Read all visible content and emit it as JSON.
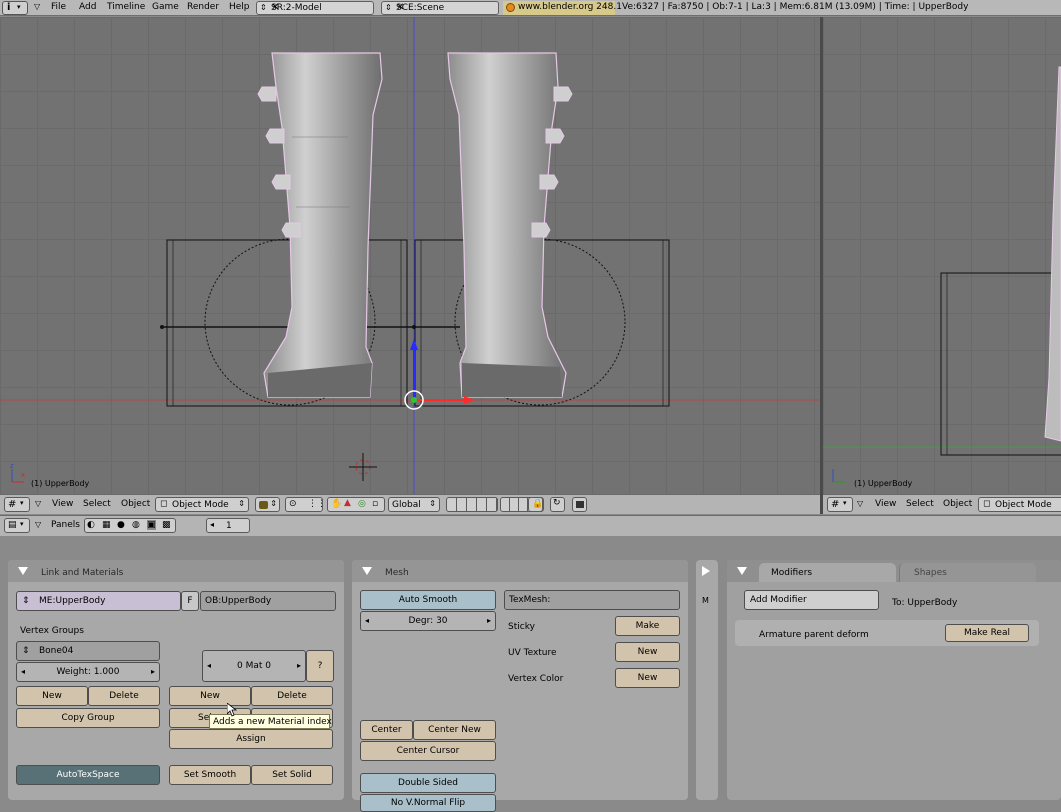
{
  "topbar": {
    "menus": [
      "File",
      "Add",
      "Timeline",
      "Game",
      "Render",
      "Help"
    ],
    "screen_field": "SR:2-Model",
    "scene_field": "SCE:Scene",
    "site": "www.blender.org 248.1",
    "stats": "Ve:6327 | Fa:8750 | Ob:7-1 | La:3 | Mem:6.81M (13.09M) | Time: | UpperBody"
  },
  "viewport_main": {
    "object_label": "(1) UpperBody"
  },
  "viewport_side": {
    "object_label": "(1) UpperBody"
  },
  "header_main": {
    "menus": [
      "View",
      "Select",
      "Object"
    ],
    "mode": "Object Mode",
    "orientation": "Global"
  },
  "header_side": {
    "menus": [
      "View",
      "Select",
      "Object"
    ],
    "mode": "Object Mode"
  },
  "buttons_header": {
    "panels_label": "Panels",
    "frame": "1"
  },
  "link_materials": {
    "title": "Link and Materials",
    "mesh_name": "ME:UpperBody",
    "fake_user": "F",
    "object_name": "OB:UpperBody",
    "vertex_groups_label": "Vertex Groups",
    "group_name": "Bone04",
    "weight": "Weight: 1.000",
    "new": "New",
    "delete": "Delete",
    "copy_group": "Copy Group",
    "mat_index": "0 Mat 0",
    "question": "?",
    "mat_new": "New",
    "mat_delete": "Delete",
    "select_partial": "Sel",
    "assign": "Assign",
    "tooltip": "Adds a new Material index",
    "autotexspace": "AutoTexSpace",
    "set_smooth": "Set Smooth",
    "set_solid": "Set Solid"
  },
  "mesh": {
    "title": "Mesh",
    "auto_smooth": "Auto Smooth",
    "degr": "Degr: 30",
    "texmesh": "TexMesh:",
    "sticky": "Sticky",
    "sticky_btn": "Make",
    "uv_texture": "UV Texture",
    "uv_btn": "New",
    "vertex_color": "Vertex Color",
    "vc_btn": "New",
    "center": "Center",
    "center_new": "Center New",
    "center_cursor": "Center Cursor",
    "double_sided": "Double Sided",
    "no_vnormal_flip": "No V.Normal Flip"
  },
  "side_strip": {
    "letter": "M"
  },
  "modifiers": {
    "tab_modifiers": "Modifiers",
    "tab_shapes": "Shapes",
    "add_modifier": "Add Modifier",
    "to_label": "To: UpperBody",
    "armature_label": "Armature parent deform",
    "make_real": "Make Real"
  }
}
